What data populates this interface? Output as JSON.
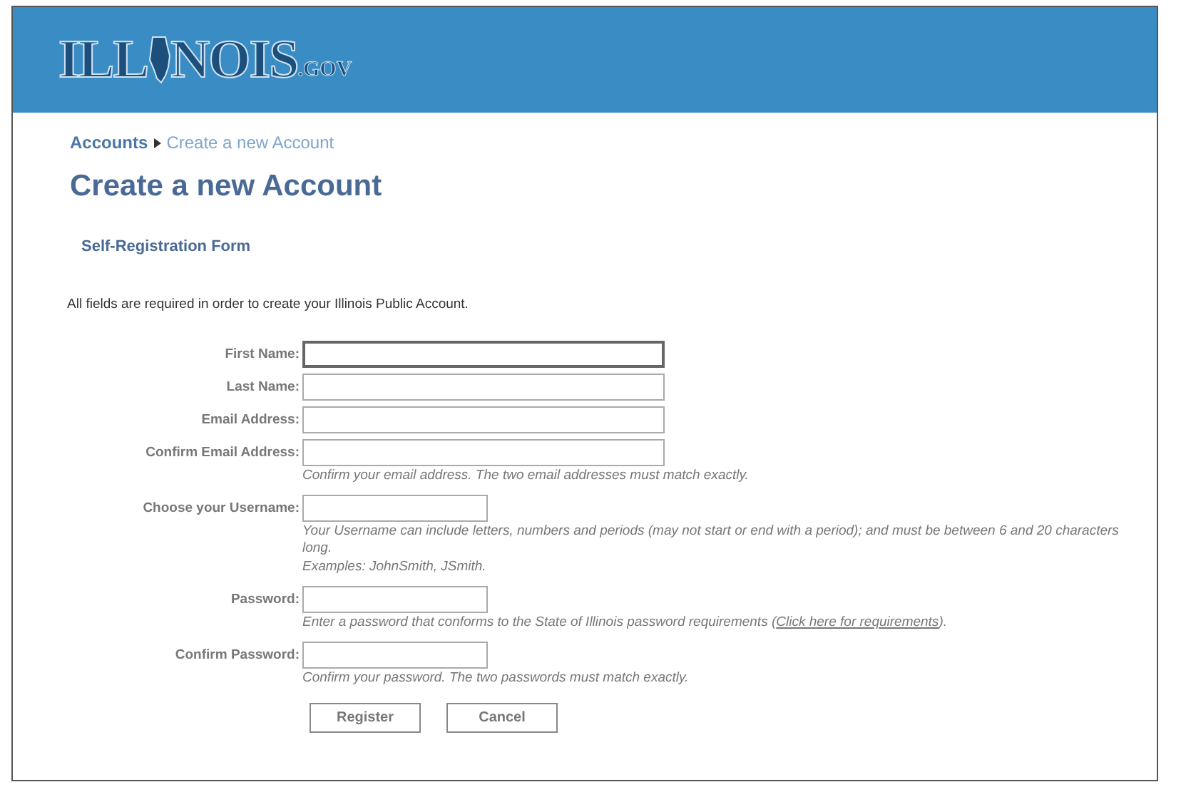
{
  "header": {
    "logo_left": "ILL",
    "logo_right": "NOIS",
    "logo_suffix": ".GOV"
  },
  "breadcrumb": [
    {
      "label": "Accounts",
      "current": false
    },
    {
      "label": "Create a new Account",
      "current": true
    }
  ],
  "title": "Create a new Account",
  "form_title": "Self-Registration Form",
  "intro": "All fields are required in order to create your Illinois Public Account.",
  "fields": [
    {
      "label": "First Name:",
      "kind": "wide",
      "focused": true
    },
    {
      "label": "Last Name:",
      "kind": "wide",
      "focused": false
    },
    {
      "label": "Email Address:",
      "kind": "wide",
      "focused": false
    },
    {
      "label": "Confirm Email Address:",
      "kind": "wide",
      "focused": false,
      "hints": [
        {
          "text": "Confirm your email address. The two email addresses must match exactly."
        }
      ]
    },
    {
      "label": "Choose your Username:",
      "kind": "narrow",
      "focused": false,
      "hints": [
        {
          "text": "Your Username can include letters, numbers  and periods (may not start or end with a period); and must be between 6 and 20 characters long."
        },
        {
          "text": "Examples: JohnSmith, JSmith."
        }
      ]
    },
    {
      "label": "Password:",
      "kind": "narrow",
      "focused": false,
      "hints": [
        {
          "text": "Enter a password that conforms to the State of Illinois password requirements (",
          "link": "Click here for requirements",
          "after": ")."
        }
      ]
    },
    {
      "label": "Confirm Password:",
      "kind": "narrow",
      "focused": false,
      "hints": [
        {
          "text": "Confirm your password. The two passwords must match exactly."
        }
      ]
    }
  ],
  "buttons": [
    "Register",
    "Cancel"
  ]
}
